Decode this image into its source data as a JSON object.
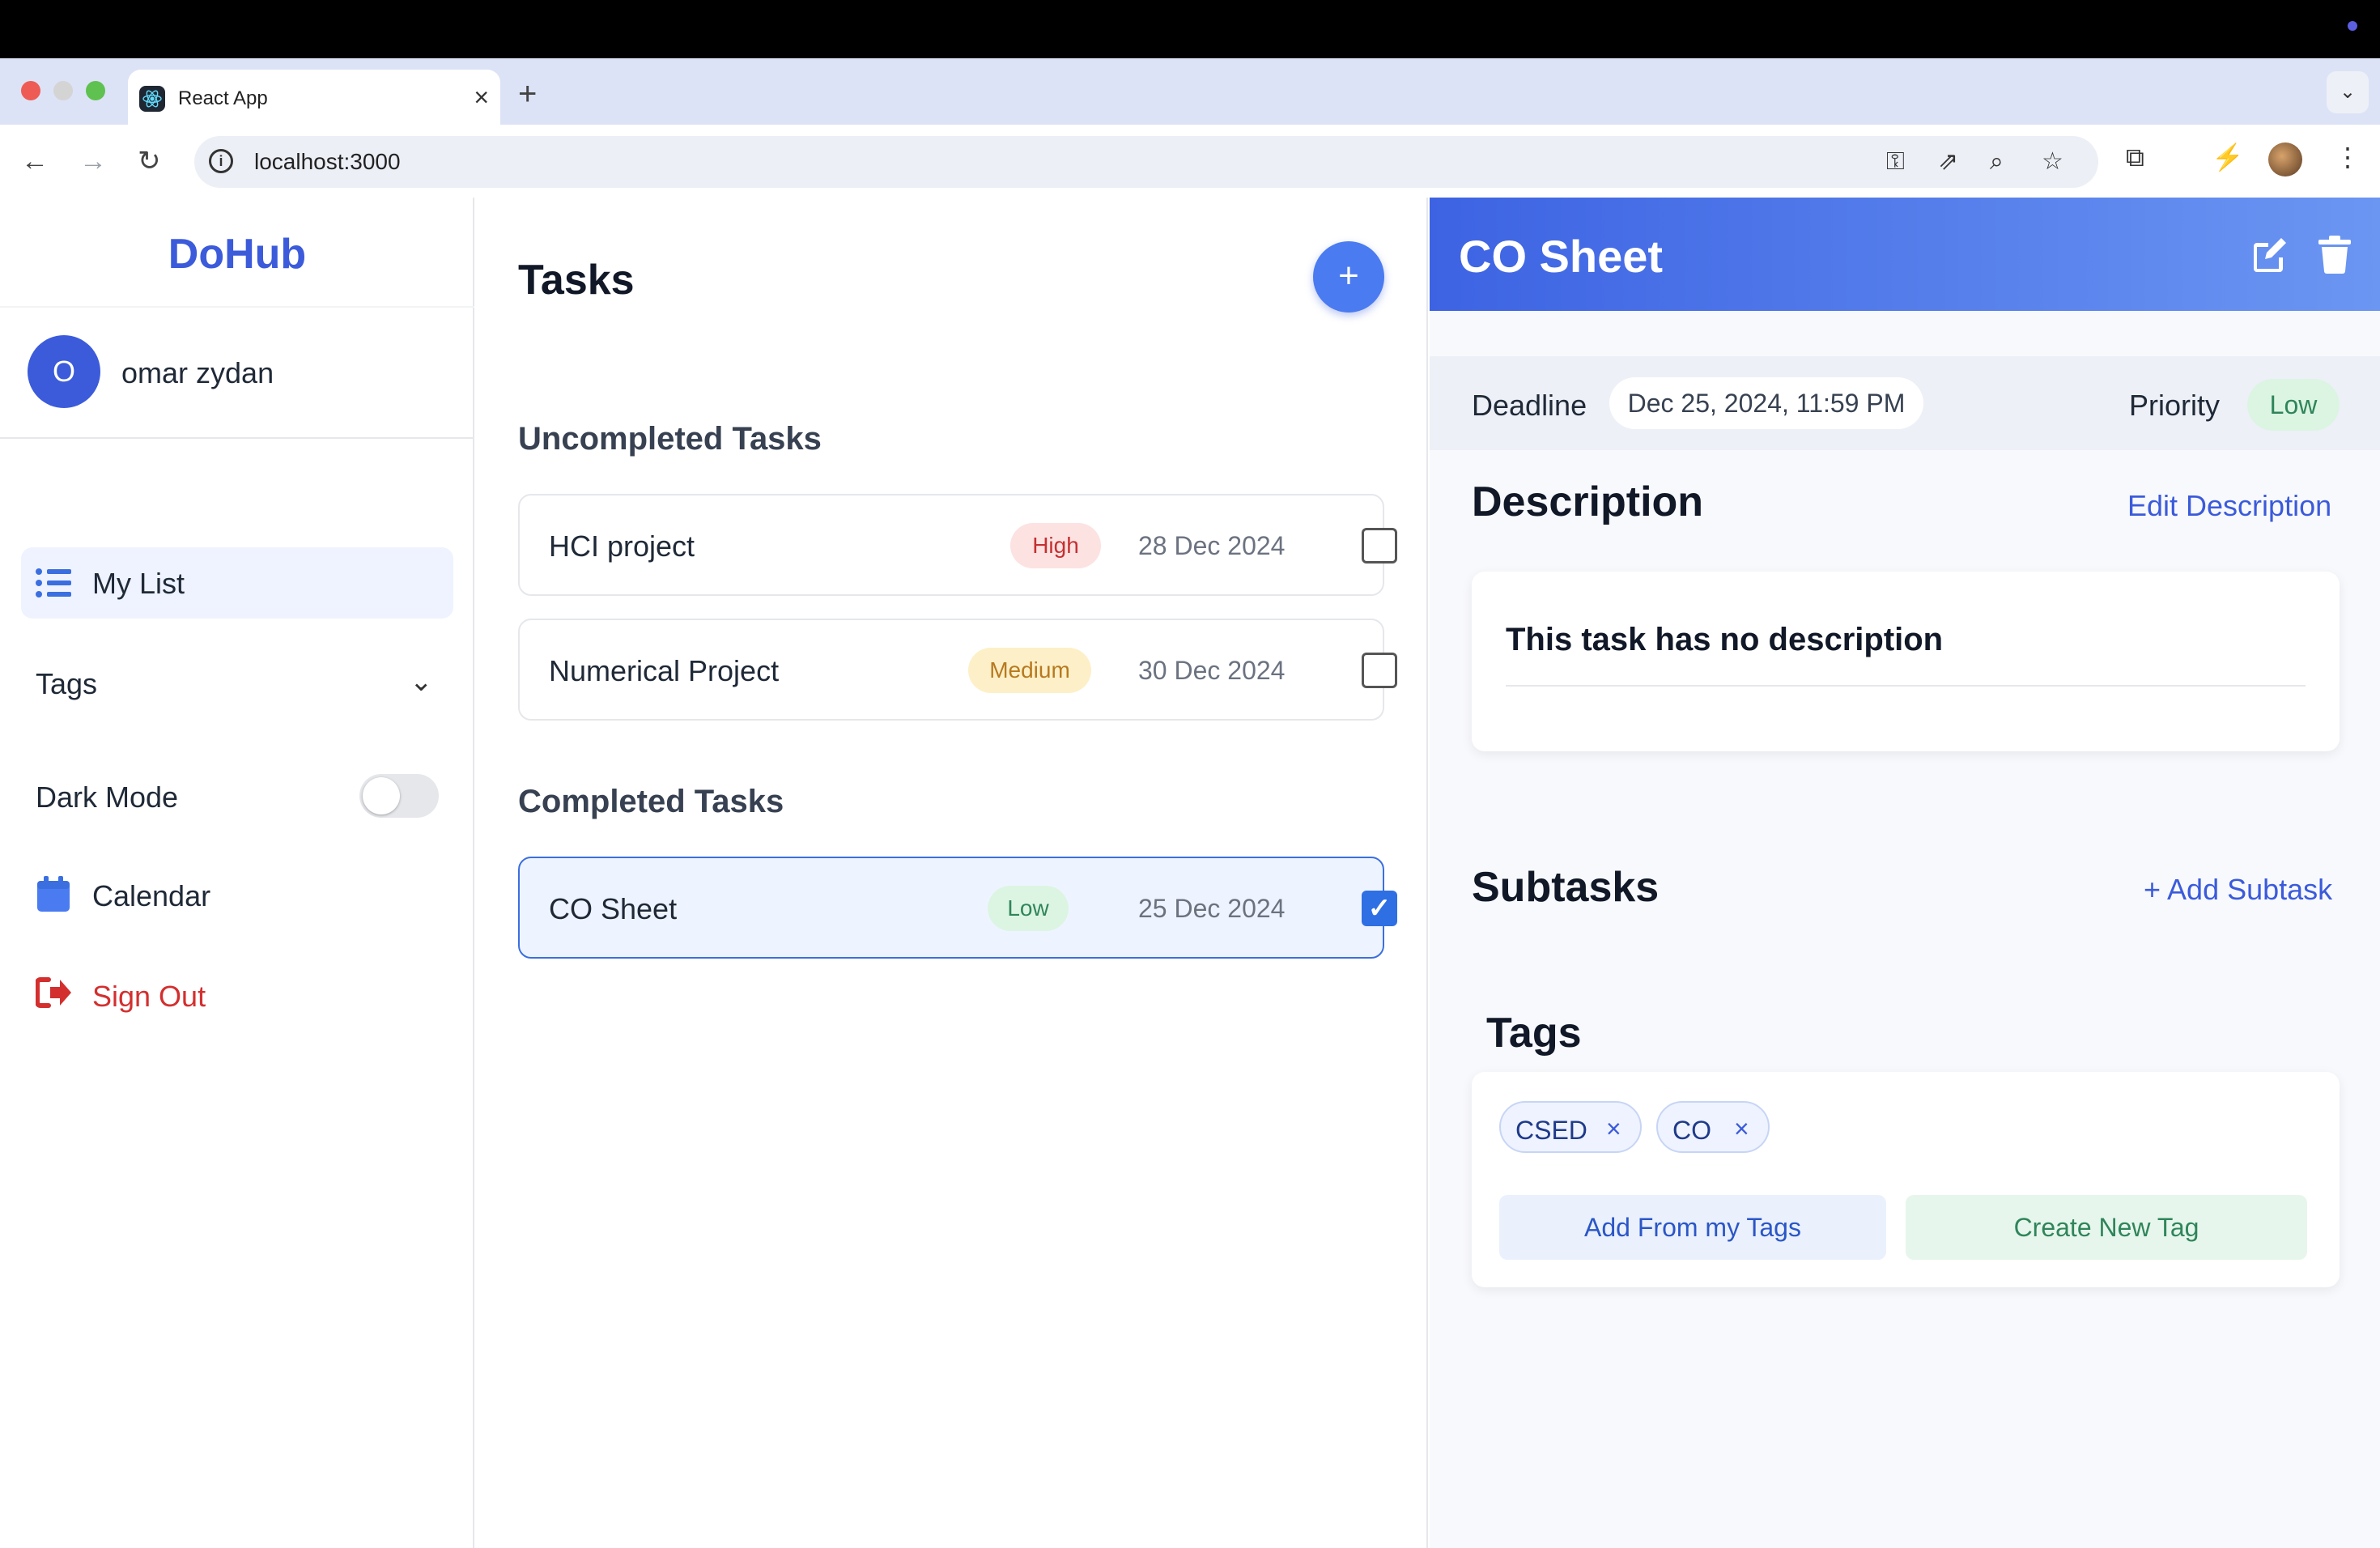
{
  "browser": {
    "tab_title": "React App",
    "new_tab_symbol": "+",
    "close_symbol": "×",
    "url": "localhost:3000"
  },
  "sidebar": {
    "brand": "DoHub",
    "user": {
      "initial": "O",
      "name": "omar zydan"
    },
    "nav": {
      "my_list": "My List",
      "tags": "Tags",
      "dark_mode": "Dark Mode",
      "dark_mode_on": false,
      "calendar": "Calendar",
      "sign_out": "Sign Out"
    }
  },
  "tasks_panel": {
    "title": "Tasks",
    "add_symbol": "+",
    "uncompleted_title": "Uncompleted Tasks",
    "completed_title": "Completed Tasks",
    "uncompleted": [
      {
        "name": "HCI project",
        "priority": "High",
        "date": "28 Dec 2024",
        "done": false
      },
      {
        "name": "Numerical Project",
        "priority": "Medium",
        "date": "30 Dec 2024",
        "done": false
      }
    ],
    "completed": [
      {
        "name": "CO Sheet",
        "priority": "Low",
        "date": "25 Dec 2024",
        "done": true
      }
    ]
  },
  "detail": {
    "title": "CO Sheet",
    "deadline_label": "Deadline",
    "deadline_value": "Dec 25, 2024, 11:59 PM",
    "priority_label": "Priority",
    "priority_value": "Low",
    "description_title": "Description",
    "edit_description": "Edit Description",
    "description_text": "This task has no description",
    "subtasks_title": "Subtasks",
    "add_subtask": "+ Add Subtask",
    "tags_title": "Tags",
    "tags": [
      {
        "label": "CSED",
        "remove": "×"
      },
      {
        "label": "CO",
        "remove": "×"
      }
    ],
    "add_from_tags": "Add From my Tags",
    "create_tag": "Create New Tag"
  },
  "colors": {
    "accent": "#3b5bdb",
    "header_gradient_start": "#3d63e3",
    "header_gradient_end": "#6b96f2",
    "danger": "#d32f2f"
  }
}
